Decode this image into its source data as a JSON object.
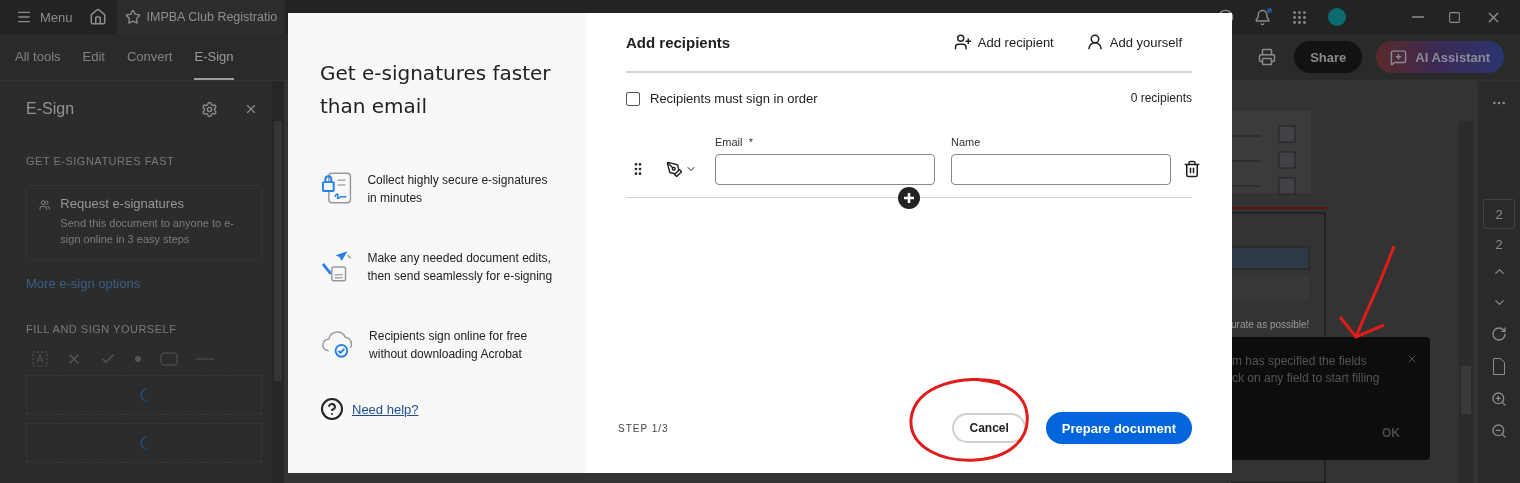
{
  "titlebar": {
    "menu_label": "Menu",
    "tab_title": "IMPBA Club Registratio"
  },
  "toolbar": {
    "tabs": [
      {
        "label": "All tools",
        "selected": false
      },
      {
        "label": "Edit",
        "selected": false
      },
      {
        "label": "Convert",
        "selected": false
      },
      {
        "label": "E-Sign",
        "selected": true
      }
    ],
    "share": "Share",
    "ai_assistant": "AI Assistant"
  },
  "side_panel": {
    "title": "E-Sign",
    "section_1": "GET E-SIGNATURES FAST",
    "card": {
      "title": "Request e-signatures",
      "description": "Send this document to anyone to e-sign online in 3 easy steps"
    },
    "link": "More e-sign options",
    "section_2": "FILL AND SIGN YOURSELF"
  },
  "document": {
    "visible_text": "urate as possible!"
  },
  "page_nav": {
    "current": "2",
    "total": "2"
  },
  "toast": {
    "lines": [
      "m has specified the fields",
      "ck on any field to start filling"
    ],
    "ok": "OK"
  },
  "dialog": {
    "title": "Get e-signatures faster than email",
    "features": [
      {
        "kind": "secure",
        "text": "Collect highly secure e-signatures in minutes"
      },
      {
        "kind": "edit",
        "text": "Make any needed document edits, then send seamlessly for e-signing"
      },
      {
        "kind": "cloud",
        "text": "Recipients sign online for free without downloading Acrobat"
      }
    ],
    "help_link": "Need help?",
    "heading": "Add recipients",
    "actions": [
      {
        "kind": "add_recipient",
        "label": "Add recipient"
      },
      {
        "kind": "add_yourself",
        "label": "Add yourself"
      }
    ],
    "order_checkbox": {
      "label": "Recipients must sign in order",
      "checked": false
    },
    "count": "0 recipients",
    "recipients": [
      {
        "email_label": "Email",
        "required_mark": "*",
        "name_label": "Name"
      }
    ],
    "step": "STEP 1/3",
    "cancel": "Cancel",
    "primary": "Prepare document"
  }
}
